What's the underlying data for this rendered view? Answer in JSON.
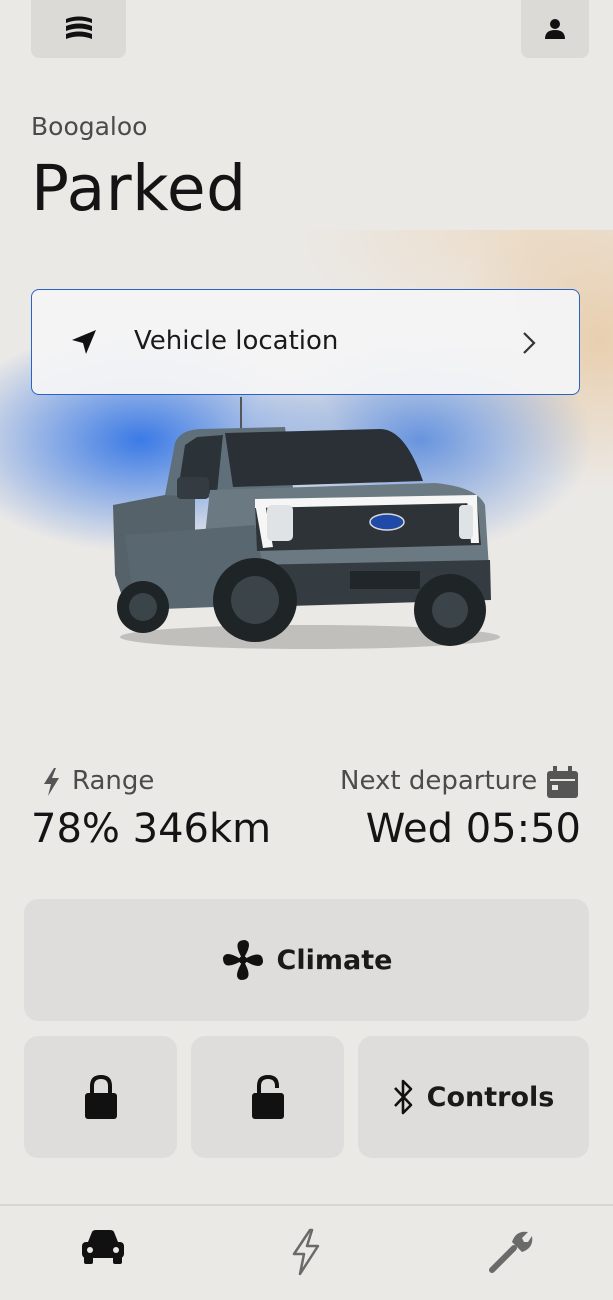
{
  "vehicle": {
    "name": "Boogaloo",
    "status": "Parked"
  },
  "location_card": {
    "label": "Vehicle location",
    "icon": "location-arrow-icon"
  },
  "range": {
    "label": "Range",
    "value": "78% 346km",
    "icon": "lightning-icon"
  },
  "departure": {
    "label": "Next departure",
    "value": "Wed 05:50",
    "icon": "calendar-icon"
  },
  "actions": {
    "climate_label": "Climate",
    "controls_label": "Controls",
    "lock_icon": "lock-icon",
    "unlock_icon": "unlock-icon"
  },
  "nav": {
    "items": [
      {
        "name": "vehicle",
        "icon": "car-icon",
        "active": true
      },
      {
        "name": "charging",
        "icon": "lightning-icon",
        "active": false
      },
      {
        "name": "service",
        "icon": "wrench-icon",
        "active": false
      }
    ]
  },
  "colors": {
    "accent": "#2a63c6",
    "background": "#ebe9e6",
    "tile": "#dfdddb"
  }
}
